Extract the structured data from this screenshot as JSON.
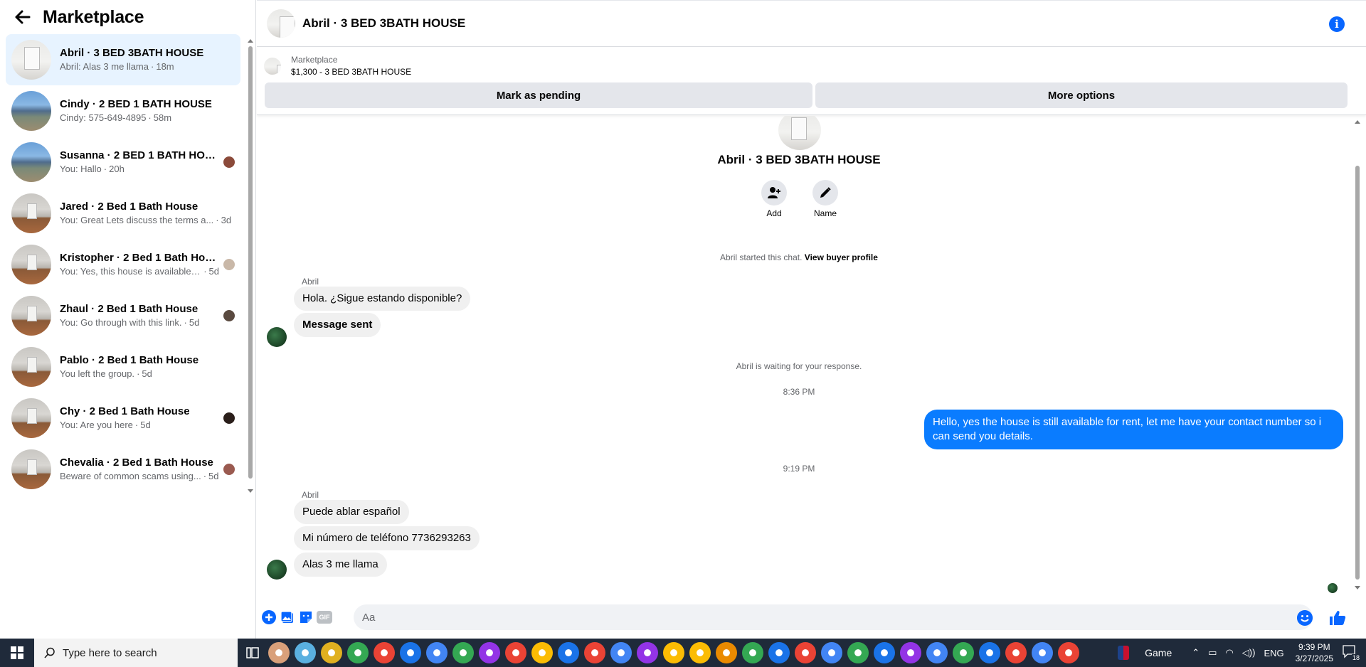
{
  "sidebar": {
    "title": "Marketplace",
    "conversations": [
      {
        "name": "Abril · 3 BED 3BATH HOUSE",
        "snippet": "Abril: Alas 3 me llama",
        "time": "18m",
        "thumb": "white",
        "active": true,
        "seen": false
      },
      {
        "name": "Cindy · 2 BED 1 BATH HOUSE",
        "snippet": "Cindy: 575-649-4895",
        "time": "58m",
        "thumb": "yard",
        "active": false,
        "seen": false
      },
      {
        "name": "Susanna · 2 BED 1 BATH HOUSE",
        "snippet": "You: Hallo",
        "time": "20h",
        "thumb": "yard",
        "active": false,
        "seen": true,
        "seenColor": "#8b4a3a"
      },
      {
        "name": "Jared · 2 Bed 1 Bath House",
        "snippet": "You: Great Lets discuss the terms a...",
        "time": "3d",
        "thumb": "room",
        "active": false,
        "seen": false
      },
      {
        "name": "Kristopher · 2 Bed 1 Bath House",
        "snippet": "You: Yes, this house is available. ...",
        "time": "5d",
        "thumb": "room",
        "active": false,
        "seen": true,
        "seenColor": "#c9b8a8"
      },
      {
        "name": "Zhaul · 2 Bed 1 Bath House",
        "snippet": "You: Go through with this link.",
        "time": "5d",
        "thumb": "room",
        "active": false,
        "seen": true,
        "seenColor": "#5a4a40"
      },
      {
        "name": "Pablo · 2 Bed 1 Bath House",
        "snippet": "You left the group.",
        "time": "5d",
        "thumb": "room",
        "active": false,
        "seen": false
      },
      {
        "name": "Chy · 2 Bed 1 Bath House",
        "snippet": "You: Are you here",
        "time": "5d",
        "thumb": "room",
        "active": false,
        "seen": true,
        "seenColor": "#2a1e1a"
      },
      {
        "name": "Chevalia · 2 Bed 1 Bath House",
        "snippet": "Beware of common scams using...",
        "time": "5d",
        "thumb": "room",
        "active": false,
        "seen": true,
        "seenColor": "#9a5a50"
      }
    ]
  },
  "header": {
    "title": "Abril · 3 BED 3BATH HOUSE"
  },
  "listing": {
    "category": "Marketplace",
    "price_title": "$1,300 - 3 BED 3BATH HOUSE",
    "pending_label": "Mark as pending",
    "more_label": "More options"
  },
  "profile": {
    "name": "Abril · 3 BED 3BATH HOUSE",
    "add_label": "Add",
    "name_label": "Name"
  },
  "chat": {
    "started_text": "Abril started this chat.",
    "view_profile": "View buyer profile",
    "sender1": "Abril",
    "msg1": "Hola. ¿Sigue estando disponible?",
    "msg2": "Message sent",
    "waiting": "Abril is waiting for your response.",
    "time1": "8:36 PM",
    "reply": "Hello, yes the house is still available for rent, let me have your contact number so i can send you details.",
    "time2": "9:19 PM",
    "sender2": "Abril",
    "msg3": "Puede ablar español",
    "msg4": "Mi número de teléfono  7736293263",
    "msg5": "Alas 3 me llama"
  },
  "composer": {
    "placeholder": "Aa"
  },
  "taskbar": {
    "search_placeholder": "Type here to search",
    "game_label": "Game",
    "lang": "ENG",
    "time": "9:39 PM",
    "date": "3/27/2025",
    "notifications": "18",
    "app_icon_colors": [
      "#d9a07a",
      "#5ab0e0",
      "#e0b020",
      "#34a853",
      "#ea4335",
      "#1a73e8",
      "#4285f4",
      "#34a853",
      "#9334e6",
      "#ea4335",
      "#fbbc04",
      "#1a73e8",
      "#ea4335",
      "#4285f4",
      "#9334e6",
      "#fbbc04",
      "#fbbc04",
      "#ea8a00",
      "#34a853",
      "#1a73e8",
      "#ea4335",
      "#4285f4",
      "#34a853",
      "#1a73e8",
      "#9334e6",
      "#4285f4",
      "#34a853",
      "#1a73e8",
      "#ea4335",
      "#4285f4",
      "#ea4335"
    ]
  },
  "colors": {
    "accent": "#0866ff",
    "my_bubble": "#0a7cff",
    "active_conv": "#e7f3ff"
  }
}
